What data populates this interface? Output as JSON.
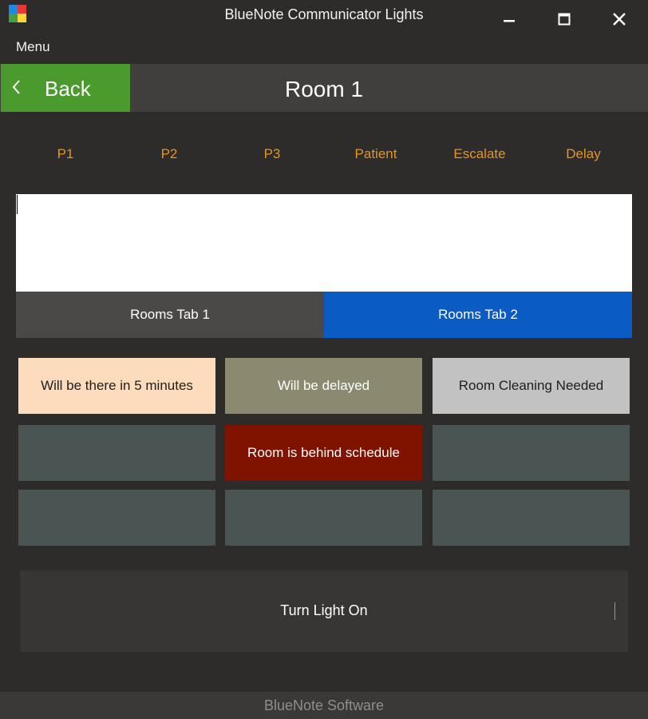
{
  "window": {
    "title": "BlueNote Communicator Lights",
    "controls": [
      "minimize",
      "maximize",
      "close"
    ]
  },
  "menubar": {
    "menu_label": "Menu"
  },
  "header": {
    "back_label": "Back",
    "room_title": "Room 1"
  },
  "priority_options": [
    "P1",
    "P2",
    "P3",
    "Patient",
    "Escalate",
    "Delay"
  ],
  "message_input": {
    "value": ""
  },
  "tabs": [
    {
      "label": "Rooms Tab 1",
      "selected": false
    },
    {
      "label": "Rooms Tab 2",
      "selected": true
    }
  ],
  "quick_messages": [
    {
      "label": "Will be there in 5 minutes",
      "bg": "#fddbbd",
      "fg": "#1e1e1e"
    },
    {
      "label": "Will be delayed",
      "bg": "#8b8a70",
      "fg": "#ffffff"
    },
    {
      "label": "Room Cleaning Needed",
      "bg": "#c2c2c2",
      "fg": "#1e1e1e"
    },
    {
      "label": "",
      "bg": "#4a5452",
      "fg": "#ffffff"
    },
    {
      "label": "Room is behind schedule",
      "bg": "#801200",
      "fg": "#ffffff"
    },
    {
      "label": "",
      "bg": "#4a5452",
      "fg": "#ffffff"
    },
    {
      "label": "",
      "bg": "#4a5452",
      "fg": "#ffffff"
    },
    {
      "label": "",
      "bg": "#4a5452",
      "fg": "#ffffff"
    },
    {
      "label": "",
      "bg": "#4a5452",
      "fg": "#ffffff"
    }
  ],
  "action": {
    "turn_light_label": "Turn Light On"
  },
  "footer": {
    "text": "BlueNote Software"
  },
  "colors": {
    "background": "#2d2c2b",
    "header": "#413f3e",
    "back_button": "#4a9a2e",
    "priority_text": "#e8951a",
    "tab_inactive": "#4a4948",
    "tab_active": "#0a5bc4",
    "footer": "#3a3938"
  },
  "icons": {
    "app": "windows-logo-icon",
    "back": "chevron-left-icon",
    "minimize": "minimize-icon",
    "maximize": "maximize-icon",
    "close": "close-icon"
  }
}
